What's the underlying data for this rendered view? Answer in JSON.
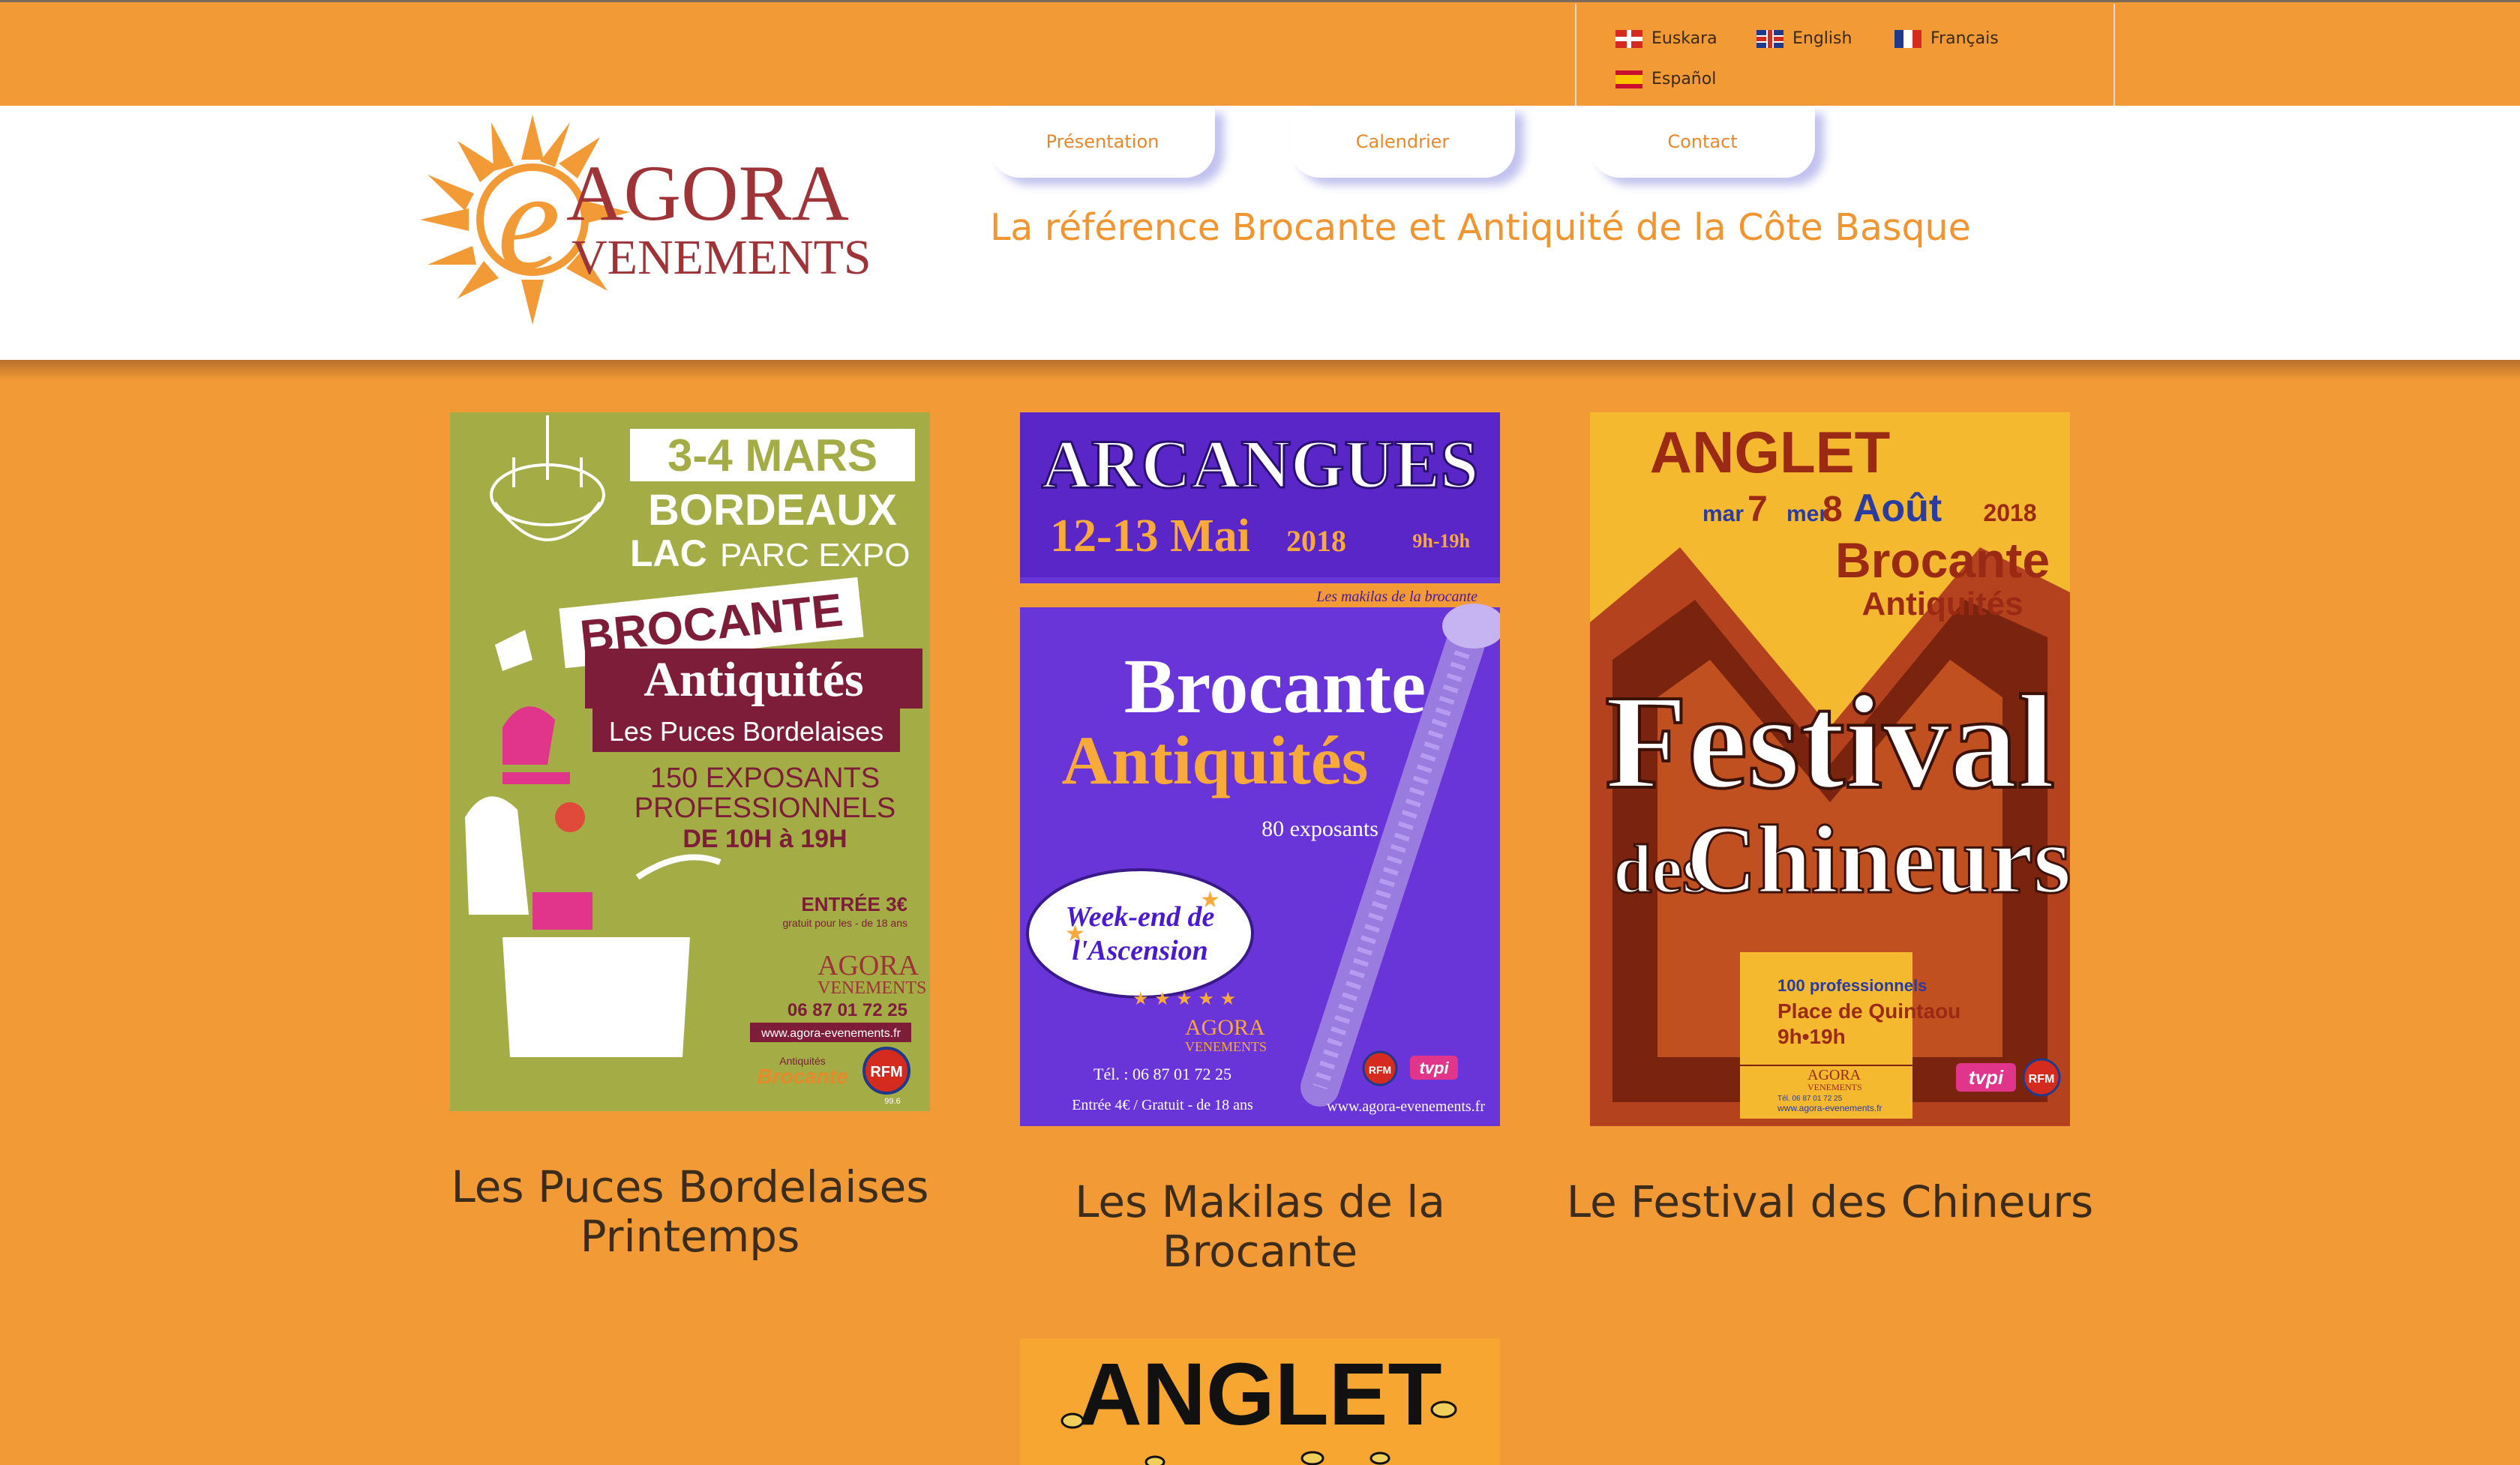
{
  "languages": [
    {
      "label": "Euskara",
      "flag": "basque-flag-icon"
    },
    {
      "label": "English",
      "flag": "uk-flag-icon"
    },
    {
      "label": "Français",
      "flag": "france-flag-icon"
    },
    {
      "label": "Español",
      "flag": "spain-flag-icon"
    }
  ],
  "logo": {
    "line1": "AGORA",
    "line2": "VENEMENTS",
    "initial": "e"
  },
  "nav": [
    {
      "label": "Présentation"
    },
    {
      "label": "Calendrier"
    },
    {
      "label": "Contact"
    }
  ],
  "tagline": "La référence Brocante et Antiquité de la Côte Basque",
  "colors": {
    "page_bg": "#f29a36",
    "accent": "#f0952f",
    "caption": "#3c2c1c"
  },
  "events": [
    {
      "caption": "Les Puces Bordelaises Printemps",
      "poster": {
        "dates": "3-4 MARS",
        "city": "BORDEAUX",
        "venue_a": "LAC",
        "venue_b": "PARC EXPO",
        "title1": "BROCANTE",
        "title2": "Antiquités",
        "subtitle": "Les Puces Bordelaises",
        "exhibitors1": "150 EXPOSANTS",
        "exhibitors2": "PROFESSIONNELS",
        "hours": "DE 10H à 19H",
        "entry": "ENTRÉE 3€",
        "entry_note": "gratuit pour les - de 18 ans",
        "org1": "AGORA",
        "org2": "VENEMENTS",
        "phone": "06 87 01 72 25",
        "web": "www.agora-evenements.fr",
        "sponsor": "Antiquités",
        "sponsor2": "Brocante",
        "radio": "RFM",
        "radio_freq": "99.6"
      }
    },
    {
      "caption": "Les Makilas de la Brocante",
      "poster": {
        "city": "ARCANGUES",
        "dates": "12-13 Mai",
        "year": "2018",
        "hours": "9h-19h",
        "strip": "Les makilas de la brocante",
        "title1": "Brocante",
        "title2": "Antiquités",
        "exhibitors": "80 exposants",
        "badge1": "Week-end de",
        "badge2": "l'Ascension",
        "org1": "AGORA",
        "org2": "VENEMENTS",
        "phone": "Tél. : 06 87 01 72 25",
        "entry": "Entrée 4€ / Gratuit - de 18 ans",
        "web": "www.agora-evenements.fr",
        "radio": "RFM",
        "tv": "tvpi"
      }
    },
    {
      "caption": "Le Festival des Chineurs",
      "poster": {
        "city": "ANGLET",
        "day1": "mar",
        "num1": "7",
        "day2": "mer",
        "num2": "8",
        "month": "Août",
        "year": "2018",
        "title1": "Brocante",
        "title2": "Antiquités",
        "big1": "Festival",
        "big2": "des",
        "big3": "Chineurs",
        "pros": "100 professionnels",
        "place": "Place de Quintaou",
        "hours": "9h•19h",
        "org1": "AGORA",
        "org2": "VENEMENTS",
        "phone": "Tél. 06 87 01 72 25",
        "web": "www.agora-evenements.fr",
        "tv": "tvpi",
        "radio": "RFM"
      }
    },
    {
      "poster": {
        "city": "ANGLET"
      }
    }
  ]
}
